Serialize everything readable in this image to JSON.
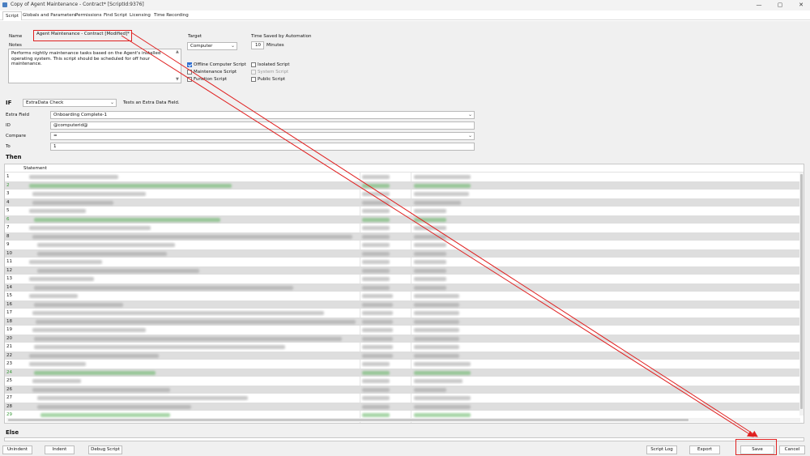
{
  "window": {
    "title": "Copy of Agent Maintenance - Contract*   [ScriptId:9376]",
    "controls": [
      "—",
      "▢",
      "✕"
    ]
  },
  "tabs": [
    {
      "label": "Script",
      "active": true
    },
    {
      "label": "Globals and Parameters"
    },
    {
      "label": "Permissions"
    },
    {
      "label": "Find Script"
    },
    {
      "label": "Licensing"
    },
    {
      "label": "Time Recording"
    }
  ],
  "form": {
    "name_label": "Name",
    "name_value": "Agent Maintenance - Contract [Modified]*",
    "notes_label": "Notes",
    "notes_value": "Performs nightly maintenance tasks based on the Agent's installed operating system.  This script should be scheduled for off hour maintenance.",
    "target_label": "Target",
    "target_value": "Computer",
    "time_saved_label": "Time Saved by Automation",
    "time_saved_value": "10",
    "time_saved_unit": "Minutes",
    "checkboxes": [
      {
        "label": "Offline Computer Script",
        "checked": true
      },
      {
        "label": "Maintenance Script",
        "checked": false
      },
      {
        "label": "Function Script",
        "checked": false
      },
      {
        "label": "Isolated Script",
        "checked": false
      },
      {
        "label": "System Script",
        "checked": false,
        "disabled": true
      },
      {
        "label": "Public Script",
        "checked": false
      }
    ]
  },
  "if_block": {
    "if_label": "IF",
    "function_value": "ExtraData Check",
    "function_desc": "Tests an Extra Data Field.",
    "extra_field_label": "Extra Field",
    "extra_field_value": "Onboarding Complete-1",
    "id_label": "ID",
    "id_value": "@computerid@",
    "compare_label": "Compare",
    "compare_value": "=",
    "to_label": "To",
    "to_value": "1"
  },
  "then_label": "Then",
  "else_label": "Else",
  "grid": {
    "statement_header": "Statement",
    "rows": [
      {
        "n": "1"
      },
      {
        "n": "2",
        "green": true
      },
      {
        "n": "3"
      },
      {
        "n": "4"
      },
      {
        "n": "5"
      },
      {
        "n": "6",
        "green": true
      },
      {
        "n": "7"
      },
      {
        "n": "8"
      },
      {
        "n": "9"
      },
      {
        "n": "10"
      },
      {
        "n": "11"
      },
      {
        "n": "12"
      },
      {
        "n": "13"
      },
      {
        "n": "14"
      },
      {
        "n": "15"
      },
      {
        "n": "16"
      },
      {
        "n": "17"
      },
      {
        "n": "18"
      },
      {
        "n": "19"
      },
      {
        "n": "20"
      },
      {
        "n": "21"
      },
      {
        "n": "22"
      },
      {
        "n": "23"
      },
      {
        "n": "24",
        "green": true
      },
      {
        "n": "25"
      },
      {
        "n": "26"
      },
      {
        "n": "27"
      },
      {
        "n": "28"
      },
      {
        "n": "29",
        "green": true
      }
    ]
  },
  "buttons": {
    "unindent": "Unindent",
    "indent": "Indent",
    "debug": "Debug Script",
    "script_log": "Script Log",
    "export": "Export",
    "save": "Save",
    "cancel": "Cancel"
  },
  "colors": {
    "annotation": "#e02020",
    "checkbox_checked": "#2f6fd1",
    "comment_green": "#3a9a3a"
  }
}
